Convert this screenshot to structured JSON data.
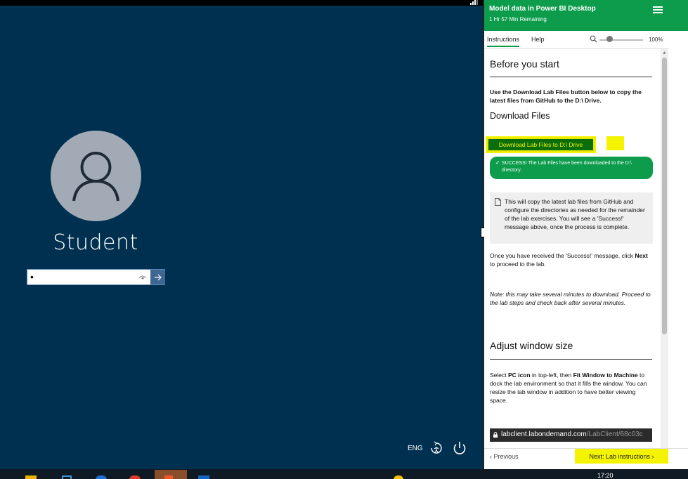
{
  "login": {
    "username": "Student",
    "password_value": "•",
    "language": "ENG"
  },
  "panel": {
    "title": "Model data in Power BI Desktop",
    "time_remaining": "1 Hr 57 Min Remaining",
    "tabs": [
      "Instructions",
      "Help"
    ],
    "zoom": "100%",
    "heading_before": "Before you start",
    "use_button_text": "Use the Download Lab Files button below to copy the latest files from GitHub to the D:\\ Drive.",
    "heading_download": "Download Files",
    "download_button": "Download Lab Files to D:\\ Drive",
    "success_message": "SUCCESS! The Lab Files have been downloaded to the D:\\ directory.",
    "note_text": "This will copy the latest lab files from GitHub and configure the directories as needed for the remainder of the lab exercises. You will see a 'Success!' message above, once the process is complete.",
    "once_pre": "Once you have received the 'Success!' message, click ",
    "once_bold": "Next",
    "once_post": " to proceed to the lab.",
    "note_italic": "Note: this may take several minutes to download. Proceed to the lab steps and check back after several minutes.",
    "heading_adjust": "Adjust window size",
    "select_1": "Select ",
    "select_b1": "PC icon",
    "select_2": " in top-left, then ",
    "select_b2": "Fit Window to Machine",
    "select_3": " to dock the lab environment so that it fills the window. You can resize the lab window in addition to have better viewing space.",
    "url_host": "labclient.labondemand.com",
    "url_path": "/LabClient/68c03c",
    "prev_label": "Previous",
    "next_label": "Next: Lab instructions"
  },
  "taskbar": {
    "clock": "17:20"
  },
  "colors": {
    "login_bg": "#00304f",
    "panel_green": "#0c9c4c",
    "highlight_yellow": "#f4f400"
  }
}
